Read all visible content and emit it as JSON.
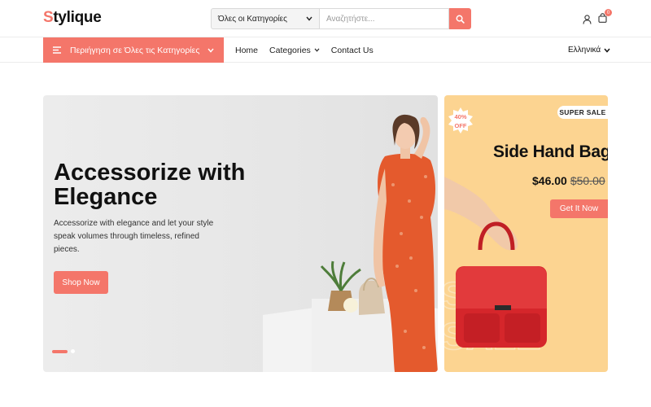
{
  "header": {
    "logo_letter": "S",
    "logo_rest": "tylique",
    "search": {
      "category_selected": "Όλες οι Κατηγορίες",
      "placeholder": "Αναζητήστε..."
    },
    "cart_count": "0"
  },
  "nav": {
    "browse_label": "Περιήγηση σε Όλες τις Κατηγορίες",
    "links": [
      "Home",
      "Categories",
      "Contact Us"
    ],
    "language": "Ελληνικά"
  },
  "hero": {
    "title": "Accessorize with Elegance",
    "description": "Accessorize with elegance and let your style speak volumes through timeless, refined pieces.",
    "cta": "Shop Now",
    "slides": 2,
    "active_slide": 1
  },
  "promo": {
    "badge": "SUPER SALE",
    "discount_percent": "40%",
    "discount_word": "OFF",
    "title": "Side Hand Bag",
    "price": "$46.00",
    "old_price": "$50.00",
    "cta": "Get It Now",
    "bg_word": "SALE"
  },
  "colors": {
    "accent": "#f4766a",
    "promo_bg": "#fcd491"
  }
}
